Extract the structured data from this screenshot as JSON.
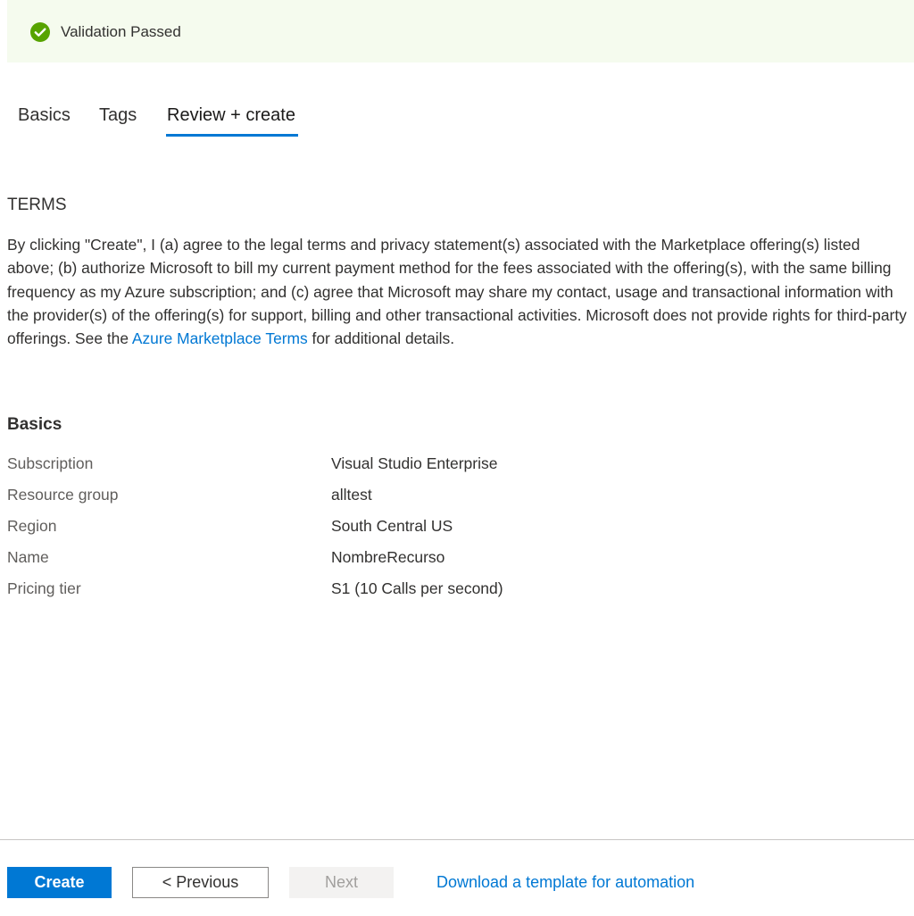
{
  "validation": {
    "text": "Validation Passed",
    "icon": "check-circle-icon",
    "color": "#57a300",
    "background": "#f5fbee"
  },
  "tabs": [
    {
      "label": "Basics",
      "active": false
    },
    {
      "label": "Tags",
      "active": false
    },
    {
      "label": "Review + create",
      "active": true
    }
  ],
  "terms": {
    "heading": "TERMS",
    "body_before_link": "By clicking \"Create\", I (a) agree to the legal terms and privacy statement(s) associated with the Marketplace offering(s) listed above; (b) authorize Microsoft to bill my current payment method for the fees associated with the offering(s), with the same billing frequency as my Azure subscription; and (c) agree that Microsoft may share my contact, usage and transactional information with the provider(s) of the offering(s) for support, billing and other transactional activities. Microsoft does not provide rights for third-party offerings. See the ",
    "link_text": "Azure Marketplace Terms",
    "body_after_link": " for additional details."
  },
  "basics": {
    "heading": "Basics",
    "rows": [
      {
        "label": "Subscription",
        "value": "Visual Studio Enterprise"
      },
      {
        "label": "Resource group",
        "value": "alltest"
      },
      {
        "label": "Region",
        "value": "South Central US"
      },
      {
        "label": "Name",
        "value": "NombreRecurso"
      },
      {
        "label": "Pricing tier",
        "value": "S1 (10 Calls per second)"
      }
    ]
  },
  "footer": {
    "create_label": "Create",
    "previous_label": "< Previous",
    "next_label": "Next",
    "download_link": "Download a template for automation"
  },
  "colors": {
    "accent": "#0078d4",
    "text": "#323130",
    "muted": "#605e5c",
    "disabled_bg": "#f3f2f1",
    "disabled_text": "#a19f9d"
  }
}
